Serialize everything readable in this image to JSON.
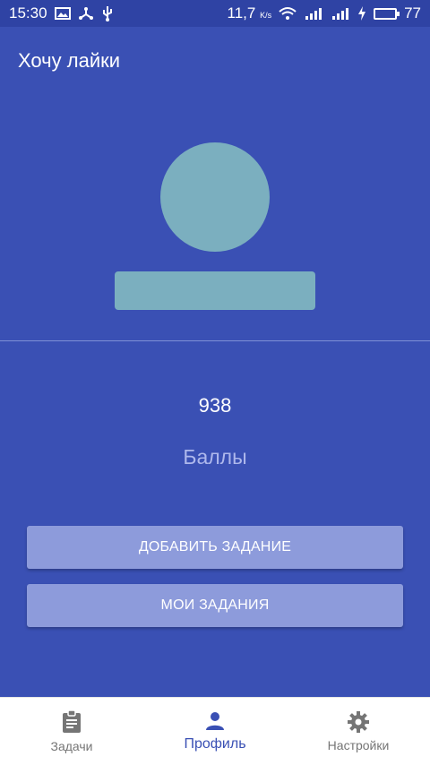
{
  "status_bar": {
    "time": "15:30",
    "network_speed": "11,7",
    "speed_unit": "K/s",
    "battery_level": "77",
    "battery_fill": 0.77,
    "icons": [
      "image-icon",
      "share-icon",
      "usb-icon",
      "wifi-icon",
      "signal-3g-icon",
      "signal-icon",
      "charging-icon",
      "battery-icon"
    ]
  },
  "app_bar": {
    "title": "Хочу лайки"
  },
  "profile": {
    "points_value": "938",
    "points_label": "Баллы"
  },
  "actions": {
    "add_task": "ДОБАВИТЬ ЗАДАНИЕ",
    "my_tasks": "МОИ ЗАДАНИЯ"
  },
  "bottom_nav": {
    "items": [
      {
        "label": "Задачи",
        "icon": "clipboard-icon"
      },
      {
        "label": "Профиль",
        "icon": "person-icon",
        "active": true
      },
      {
        "label": "Настройки",
        "icon": "gear-icon"
      }
    ]
  },
  "colors": {
    "primary": "#3a50b4",
    "status_bar": "#2f43a4",
    "placeholder": "#7bafbf",
    "button": "#8d9bdb",
    "accent_green": "#3ddc4a"
  }
}
